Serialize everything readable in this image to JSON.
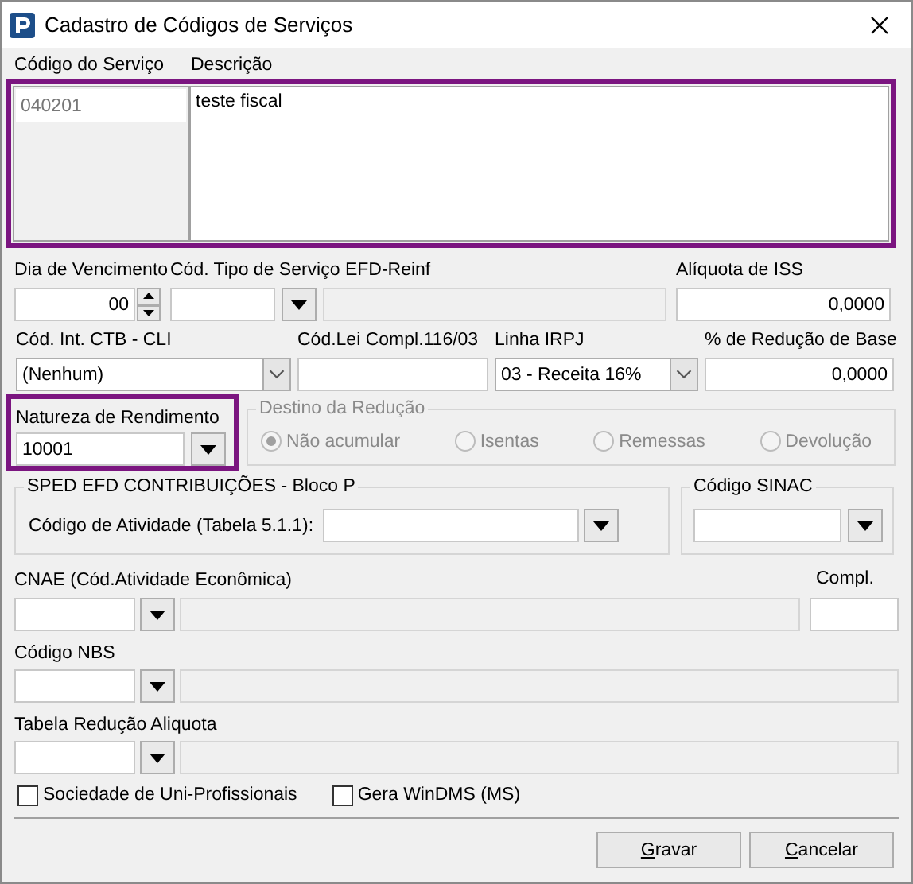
{
  "window": {
    "title": "Cadastro de Códigos de Serviços"
  },
  "main_section": {
    "highlighted": true,
    "code_label": "Código do Serviço",
    "code_value": "040201",
    "description_label": "Descrição",
    "description_value": "teste fiscal"
  },
  "fields_row1": [
    {
      "kind": "spin",
      "label": "Dia de Vencimento",
      "value": "00"
    },
    {
      "kind": "lookup",
      "label": "Cód. Tipo de Serviço EFD-Reinf"
    },
    {
      "kind": "number",
      "label": "Alíquota de ISS",
      "value": "0,0000"
    }
  ],
  "fields_row2": [
    {
      "kind": "select",
      "label": "Cód. Int. CTB - CLI",
      "value": "(Nenhum)"
    },
    {
      "kind": "text",
      "label": "Cód.Lei Compl.116/03"
    },
    {
      "kind": "select",
      "label": "Linha IRPJ",
      "value": "03 - Receita 16%"
    },
    {
      "kind": "number",
      "label": "% de Redução de Base",
      "value": "0,0000"
    }
  ],
  "natureza": {
    "label": "Natureza de Rendimento",
    "value": "10001",
    "highlighted": true
  },
  "destino": {
    "title": "Destino da Redução",
    "disabled": true,
    "options": [
      {
        "label": "Não acumular",
        "selected": true
      },
      {
        "label": "Isentas",
        "selected": false
      },
      {
        "label": "Remessas",
        "selected": false
      },
      {
        "label": "Devolução",
        "selected": false
      }
    ]
  },
  "sped": {
    "title": "SPED EFD CONTRIBUIÇÕES - Bloco P",
    "field_label": "Código de Atividade (Tabela 5.1.1):"
  },
  "sinac": {
    "title": "Código SINAC"
  },
  "cnae": {
    "label": "CNAE (Cód.Atividade Econômica)",
    "compl_label": "Compl."
  },
  "nbs": {
    "label": "Código NBS"
  },
  "tabela": {
    "label": "Tabela Redução Aliquota"
  },
  "checkboxes": [
    {
      "label": "Sociedade de Uni-Profissionais",
      "checked": false
    },
    {
      "label": "Gera WinDMS (MS)",
      "checked": false
    }
  ],
  "buttons": [
    {
      "label": "Gravar"
    },
    {
      "label": "Cancelar"
    }
  ]
}
